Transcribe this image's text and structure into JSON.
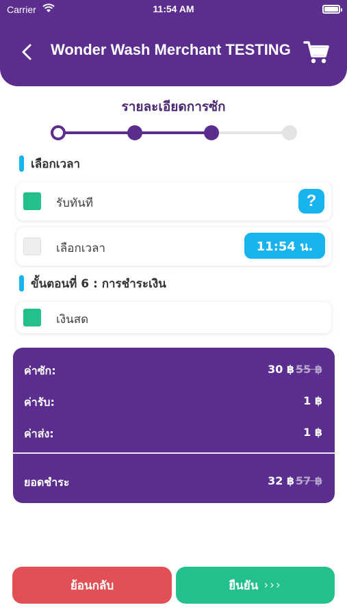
{
  "status_bar": {
    "carrier": "Carrier",
    "time": "11:54 AM"
  },
  "header": {
    "title": "Wonder Wash Merchant TESTING"
  },
  "step": {
    "title": "รายละเอียดการซัก",
    "total_steps": 4,
    "completed_steps": 3
  },
  "time_section": {
    "label": "เลือกเวลา",
    "options": [
      {
        "label": "รับทันที",
        "checked": true,
        "action": "?"
      },
      {
        "label": "เลือกเวลา",
        "checked": false,
        "action": "11:54 น."
      }
    ]
  },
  "payment_section": {
    "label": "ขั้นตอนที่ 6 : การชำระเงิน",
    "options": [
      {
        "label": "เงินสด",
        "checked": true
      }
    ]
  },
  "summary": {
    "wash": {
      "label": "ค่าซัก:",
      "value": "30 ฿",
      "original": "55 ฿"
    },
    "pickup": {
      "label": "ค่ารับ:",
      "value": "1 ฿"
    },
    "delivery": {
      "label": "ค่าส่ง:",
      "value": "1 ฿"
    },
    "total": {
      "label": "ยอดชำระ",
      "value": "32 ฿",
      "original": "57 ฿"
    }
  },
  "buttons": {
    "back": "ย้อนกลับ",
    "confirm": "ยืนยัน",
    "confirm_chevrons": "›››"
  },
  "colors": {
    "primary": "#5b2d8e",
    "accent": "#17b3ee",
    "checked": "#23c08a",
    "danger": "#e24f55"
  }
}
